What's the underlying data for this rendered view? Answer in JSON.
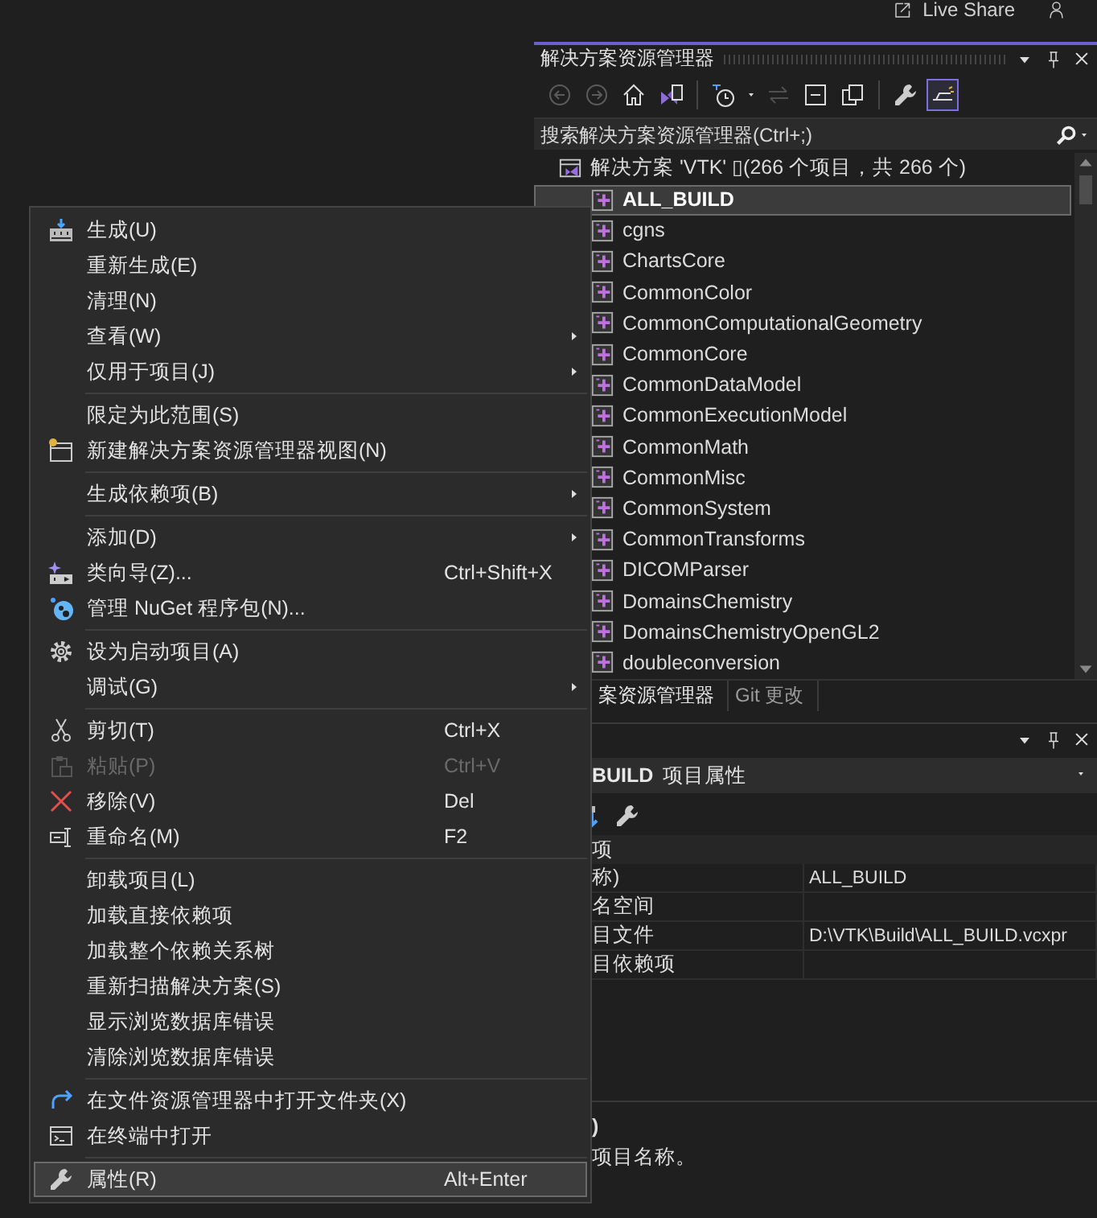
{
  "top_bar": {
    "live_share": "Live Share"
  },
  "solution_explorer": {
    "title": "解决方案资源管理器",
    "toolbar": [
      {
        "selected": false,
        "disabled": true
      },
      {
        "selected": false,
        "disabled": true
      },
      {
        "selected": false,
        "disabled": false
      },
      {
        "selected": false,
        "disabled": false
      },
      {
        "selected": false,
        "disabled": false
      },
      {
        "selected": false,
        "disabled": true
      },
      {
        "selected": false,
        "disabled": false
      },
      {
        "selected": false,
        "disabled": false
      },
      {
        "selected": false,
        "disabled": false
      },
      {
        "selected": true,
        "disabled": false
      }
    ],
    "search": {
      "placeholder": "搜索解决方案资源管理器(Ctrl+;)"
    },
    "solution": {
      "label": "解决方案 'VTK' ▯(266 个项目，共 266 个)"
    },
    "projects": [
      {
        "name": "ALL_BUILD",
        "selected": true
      },
      {
        "name": "cgns",
        "selected": false
      },
      {
        "name": "ChartsCore",
        "selected": false
      },
      {
        "name": "CommonColor",
        "selected": false
      },
      {
        "name": "CommonComputationalGeometry",
        "selected": false
      },
      {
        "name": "CommonCore",
        "selected": false
      },
      {
        "name": "CommonDataModel",
        "selected": false
      },
      {
        "name": "CommonExecutionModel",
        "selected": false
      },
      {
        "name": "CommonMath",
        "selected": false
      },
      {
        "name": "CommonMisc",
        "selected": false
      },
      {
        "name": "CommonSystem",
        "selected": false
      },
      {
        "name": "CommonTransforms",
        "selected": false
      },
      {
        "name": "DICOMParser",
        "selected": false
      },
      {
        "name": "DomainsChemistry",
        "selected": false
      },
      {
        "name": "DomainsChemistryOpenGL2",
        "selected": false
      },
      {
        "name": "doubleconversion",
        "selected": false
      }
    ],
    "tabs": [
      {
        "label": "案资源管理器",
        "selected": true
      },
      {
        "label": "Git 更改",
        "selected": false
      }
    ]
  },
  "properties": {
    "object_name": "BUILD",
    "object_type": "项目属性",
    "category": "项",
    "rows": [
      {
        "name": "称)",
        "value": "ALL_BUILD"
      },
      {
        "name": "名空间",
        "value": ""
      },
      {
        "name": "目文件",
        "value": "D:\\VTK\\Build\\ALL_BUILD.vcxpr"
      },
      {
        "name": "目依赖项",
        "value": ""
      }
    ],
    "description": {
      "title": ")",
      "text": "项目名称。"
    }
  },
  "context_menu": [
    {
      "kind": "item",
      "label": "生成(U)",
      "submenu": false,
      "disabled": false,
      "selected": false
    },
    {
      "kind": "item",
      "label": "重新生成(E)",
      "submenu": false,
      "disabled": false,
      "selected": false
    },
    {
      "kind": "item",
      "label": "清理(N)",
      "submenu": false,
      "disabled": false,
      "selected": false
    },
    {
      "kind": "item",
      "label": "查看(W)",
      "submenu": true,
      "disabled": false,
      "selected": false
    },
    {
      "kind": "item",
      "label": "仅用于项目(J)",
      "submenu": true,
      "disabled": false,
      "selected": false
    },
    {
      "kind": "separator"
    },
    {
      "kind": "item",
      "label": "限定为此范围(S)",
      "submenu": false,
      "disabled": false,
      "selected": false
    },
    {
      "kind": "item",
      "label": "新建解决方案资源管理器视图(N)",
      "submenu": false,
      "disabled": false,
      "selected": false
    },
    {
      "kind": "separator"
    },
    {
      "kind": "item",
      "label": "生成依赖项(B)",
      "submenu": true,
      "disabled": false,
      "selected": false
    },
    {
      "kind": "separator"
    },
    {
      "kind": "item",
      "label": "添加(D)",
      "submenu": true,
      "disabled": false,
      "selected": false
    },
    {
      "kind": "item",
      "label": "类向导(Z)...",
      "shortcut": "Ctrl+Shift+X",
      "submenu": false,
      "disabled": false,
      "selected": false
    },
    {
      "kind": "item",
      "label": "管理 NuGet 程序包(N)...",
      "submenu": false,
      "disabled": false,
      "selected": false
    },
    {
      "kind": "separator"
    },
    {
      "kind": "item",
      "label": "设为启动项目(A)",
      "submenu": false,
      "disabled": false,
      "selected": false
    },
    {
      "kind": "item",
      "label": "调试(G)",
      "submenu": true,
      "disabled": false,
      "selected": false
    },
    {
      "kind": "separator"
    },
    {
      "kind": "item",
      "label": "剪切(T)",
      "shortcut": "Ctrl+X",
      "submenu": false,
      "disabled": false,
      "selected": false
    },
    {
      "kind": "item",
      "label": "粘贴(P)",
      "shortcut": "Ctrl+V",
      "submenu": false,
      "disabled": true,
      "selected": false
    },
    {
      "kind": "item",
      "label": "移除(V)",
      "shortcut": "Del",
      "submenu": false,
      "disabled": false,
      "selected": false
    },
    {
      "kind": "item",
      "label": "重命名(M)",
      "shortcut": "F2",
      "submenu": false,
      "disabled": false,
      "selected": false
    },
    {
      "kind": "separator"
    },
    {
      "kind": "item",
      "label": "卸载项目(L)",
      "submenu": false,
      "disabled": false,
      "selected": false
    },
    {
      "kind": "item",
      "label": "加载直接依赖项",
      "submenu": false,
      "disabled": false,
      "selected": false
    },
    {
      "kind": "item",
      "label": "加载整个依赖关系树",
      "submenu": false,
      "disabled": false,
      "selected": false
    },
    {
      "kind": "item",
      "label": "重新扫描解决方案(S)",
      "submenu": false,
      "disabled": false,
      "selected": false
    },
    {
      "kind": "item",
      "label": "显示浏览数据库错误",
      "submenu": false,
      "disabled": false,
      "selected": false
    },
    {
      "kind": "item",
      "label": "清除浏览数据库错误",
      "submenu": false,
      "disabled": false,
      "selected": false
    },
    {
      "kind": "separator"
    },
    {
      "kind": "item",
      "label": "在文件资源管理器中打开文件夹(X)",
      "submenu": false,
      "disabled": false,
      "selected": false
    },
    {
      "kind": "item",
      "label": "在终端中打开",
      "submenu": false,
      "disabled": false,
      "selected": false
    },
    {
      "kind": "separator"
    },
    {
      "kind": "item",
      "label": "属性(R)",
      "shortcut": "Alt+Enter",
      "submenu": false,
      "disabled": false,
      "selected": true
    }
  ]
}
